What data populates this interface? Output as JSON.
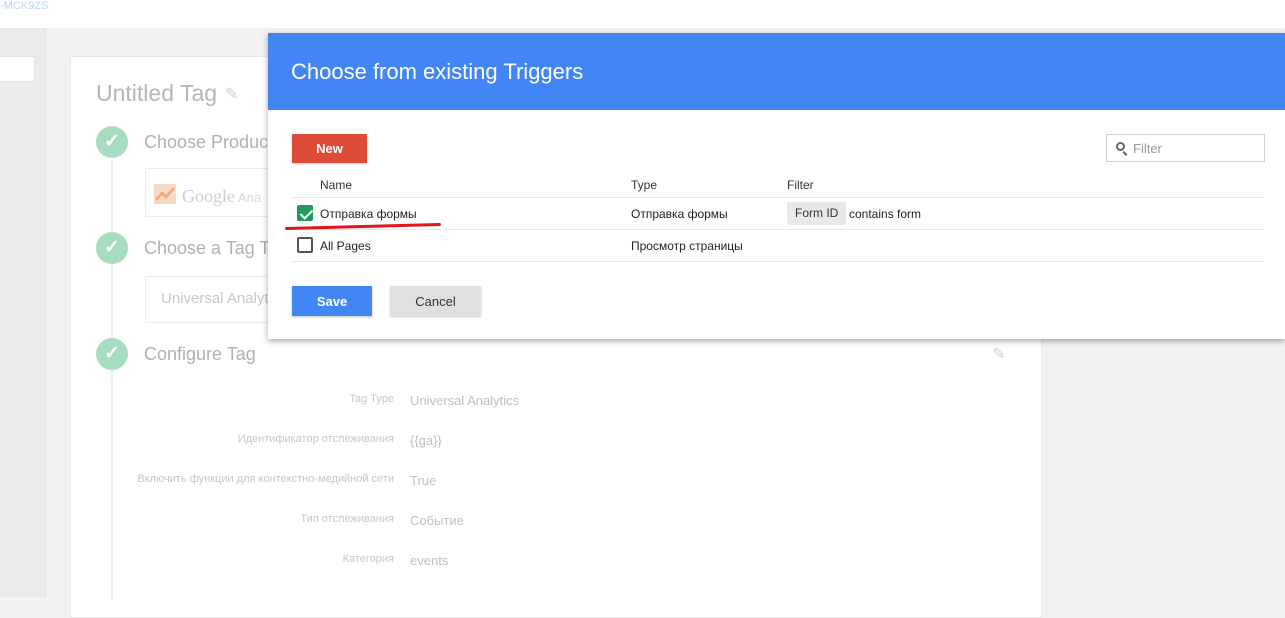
{
  "top": {
    "container_id": "-MCK9ZS"
  },
  "tag": {
    "title": "Untitled Tag",
    "steps": [
      {
        "title": "Choose Product"
      },
      {
        "title": "Choose a Tag Typ"
      },
      {
        "title": "Configure Tag"
      }
    ],
    "product_logo_text": "Google",
    "product_logo_suffix": "Ana",
    "tag_type_value": "Universal Analyt",
    "fields": [
      {
        "label": "Tag Type",
        "value": "Universal Analytics"
      },
      {
        "label": "Идентификатор отслеживания",
        "value": "{{ga}}"
      },
      {
        "label": "Включить функции для контекстно-медийной сети",
        "value": "True"
      },
      {
        "label": "Тип отслеживания",
        "value": "Событие"
      },
      {
        "label": "Категория",
        "value": "events"
      }
    ]
  },
  "dialog": {
    "title": "Choose from existing Triggers",
    "new_label": "New",
    "filter_placeholder": "Filter",
    "columns": {
      "name": "Name",
      "type": "Type",
      "filter": "Filter"
    },
    "rows": [
      {
        "name": "Отправка формы",
        "type": "Отправка формы",
        "checked": true,
        "filter_chip": "Form ID",
        "filter_text": "contains form"
      },
      {
        "name": "All Pages",
        "type": "Просмотр страницы",
        "checked": false,
        "filter_chip": "",
        "filter_text": ""
      }
    ],
    "save_label": "Save",
    "cancel_label": "Cancel"
  },
  "colors": {
    "header": "#4285f4",
    "new_button": "#dd4b39",
    "checkbox_checked": "#1f9c5a",
    "annotation": "#e0161d"
  },
  "icons": {
    "edit": "pencil-icon",
    "step": "check-circle-icon",
    "filter": "search-icon"
  }
}
